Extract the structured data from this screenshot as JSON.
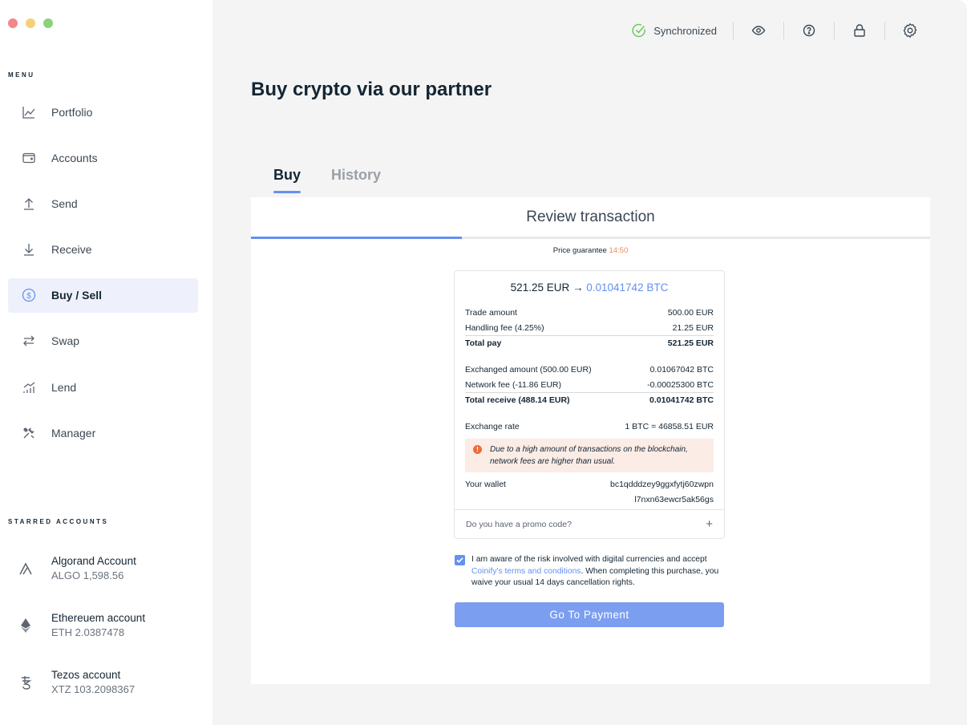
{
  "sidebar": {
    "menu_title": "MENU",
    "items": [
      {
        "label": "Portfolio",
        "icon": "chart-icon"
      },
      {
        "label": "Accounts",
        "icon": "wallet-icon"
      },
      {
        "label": "Send",
        "icon": "arrow-up-icon"
      },
      {
        "label": "Receive",
        "icon": "arrow-down-icon"
      },
      {
        "label": "Buy / Sell",
        "icon": "dollar-circle-icon",
        "active": true
      },
      {
        "label": "Swap",
        "icon": "swap-icon"
      },
      {
        "label": "Lend",
        "icon": "lend-icon"
      },
      {
        "label": "Manager",
        "icon": "tools-icon"
      }
    ],
    "starred_title": "STARRED ACCOUNTS",
    "starred": [
      {
        "name": "Algorand Account",
        "balance": "ALGO 1,598.56",
        "icon": "algorand-icon"
      },
      {
        "name": "Ethereuem account",
        "balance": "ETH 2.0387478",
        "icon": "ethereum-icon"
      },
      {
        "name": "Tezos account",
        "balance": "XTZ 103.2098367",
        "icon": "tezos-icon"
      }
    ]
  },
  "topbar": {
    "sync_label": "Synchronized",
    "icons": [
      "eye-icon",
      "help-icon",
      "lock-icon",
      "settings-icon"
    ]
  },
  "page": {
    "title": "Buy crypto via our partner",
    "tabs": [
      {
        "label": "Buy",
        "active": true
      },
      {
        "label": "History",
        "active": false
      }
    ]
  },
  "review": {
    "title": "Review transaction",
    "progress": 0.31,
    "price_guarantee_label": "Price guarantee",
    "timer": "14:50",
    "from_amount": "521.25 EUR",
    "arrow": "→",
    "to_amount": "0.01041742 BTC",
    "rows_pay": [
      {
        "label": "Trade amount",
        "value": "500.00 EUR"
      },
      {
        "label": "Handling fee (4.25%)",
        "value": "21.25 EUR"
      }
    ],
    "total_pay": {
      "label": "Total pay",
      "value": "521.25 EUR"
    },
    "rows_receive": [
      {
        "label": "Exchanged amount (500.00 EUR)",
        "value": "0.01067042 BTC"
      },
      {
        "label": "Network fee (-11.86 EUR)",
        "value": "-0.00025300 BTC"
      }
    ],
    "total_receive": {
      "label": "Total receive (488.14 EUR)",
      "value": "0.01041742 BTC"
    },
    "exchange_rate": {
      "label": "Exchange rate",
      "value": "1 BTC = 46858.51 EUR"
    },
    "warning": "Due to a high amount of transactions on the blockchain, network fees are higher than usual.",
    "wallet_label": "Your wallet",
    "wallet_line1": "bc1qdddzey9ggxfytj60zwpn",
    "wallet_line2": "l7nxn63ewcr5ak56gs",
    "promo_label": "Do you have a promo code?",
    "promo_plus": "+"
  },
  "terms": {
    "checked": true,
    "before": "I am aware of the risk involved with digital currencies and accept ",
    "link": "Coinify's terms and conditions",
    "after": ". When completing this purchase, you waive your usual 14 days cancellation rights."
  },
  "cta": {
    "label": "Go To Payment"
  },
  "colors": {
    "accent": "#6490f1",
    "timer": "#f0865c",
    "warning_bg": "#fbece6",
    "sync_ok": "#6cc95a"
  }
}
